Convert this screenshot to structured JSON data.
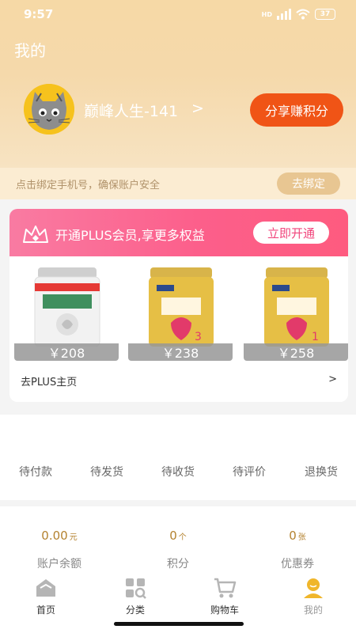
{
  "status_bar": {
    "time": "9:57",
    "network": "HD",
    "battery": "37"
  },
  "header": {
    "title": "我的",
    "username": "巅峰人生-141",
    "chevron": ">",
    "share_label": "分享赚积分"
  },
  "bind_phone": {
    "message": "点击绑定手机号，确保账户安全",
    "button_label": "去绑定"
  },
  "plus": {
    "banner_text": "开通PLUS会员,享更多权益",
    "open_label": "立即开通",
    "products": [
      {
        "price": "￥208"
      },
      {
        "price": "￥238"
      },
      {
        "price": "￥258"
      }
    ],
    "home_link": "去PLUS主页",
    "home_arrow": ">"
  },
  "orders": {
    "tabs": [
      "待付款",
      "待发货",
      "待收货",
      "待评价",
      "退换货"
    ]
  },
  "assets": [
    {
      "value": "0.00",
      "unit": "元",
      "label": "账户余额"
    },
    {
      "value": "0",
      "unit": "个",
      "label": "积分"
    },
    {
      "value": "0",
      "unit": "张",
      "label": "优惠券"
    }
  ],
  "tabbar": {
    "items": [
      {
        "label": "首页",
        "icon": "home-icon"
      },
      {
        "label": "分类",
        "icon": "category-icon"
      },
      {
        "label": "购物车",
        "icon": "cart-icon"
      },
      {
        "label": "我的",
        "icon": "profile-icon"
      }
    ]
  },
  "colors": {
    "accent": "#f05416",
    "plus_pink": "#fc5f8b",
    "gold": "#b4822f",
    "header_bg": "#f6d9a6"
  }
}
